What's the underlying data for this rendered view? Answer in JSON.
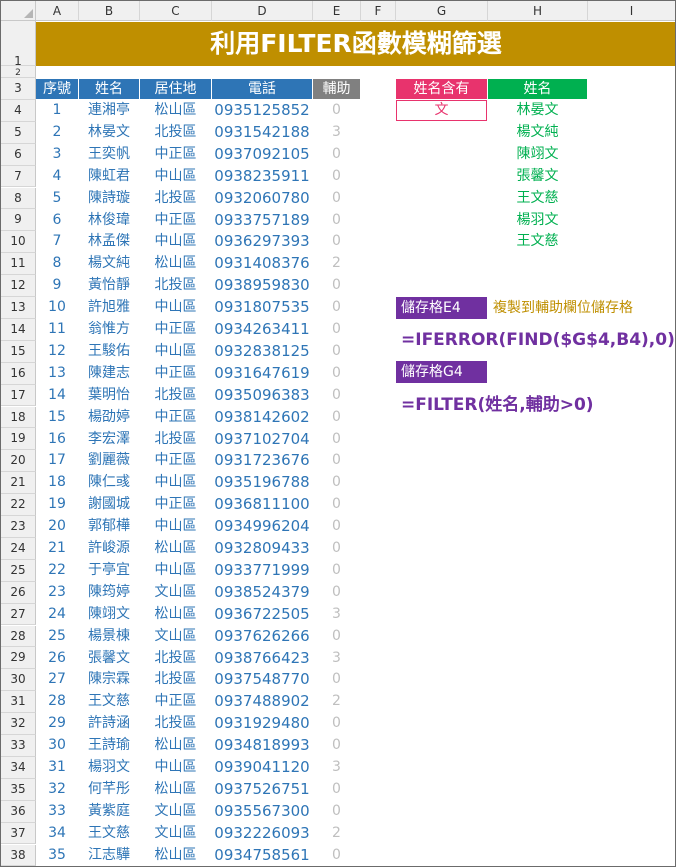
{
  "columns": [
    "A",
    "B",
    "C",
    "D",
    "E",
    "F",
    "G",
    "H",
    "I"
  ],
  "title": "利用FILTER函數模糊篩選",
  "table_headers": {
    "seq": "序號",
    "name": "姓名",
    "area": "居住地",
    "phone": "電話",
    "helper": "輔助"
  },
  "rows": [
    {
      "seq": "1",
      "name": "連湘亭",
      "area": "松山區",
      "phone": "0935125852",
      "helper": "0"
    },
    {
      "seq": "2",
      "name": "林晏文",
      "area": "北投區",
      "phone": "0931542188",
      "helper": "3"
    },
    {
      "seq": "3",
      "name": "王奕帆",
      "area": "中正區",
      "phone": "0937092105",
      "helper": "0"
    },
    {
      "seq": "4",
      "name": "陳虹君",
      "area": "中山區",
      "phone": "0938235911",
      "helper": "0"
    },
    {
      "seq": "5",
      "name": "陳詩璇",
      "area": "北投區",
      "phone": "0932060780",
      "helper": "0"
    },
    {
      "seq": "6",
      "name": "林俊瑋",
      "area": "中正區",
      "phone": "0933757189",
      "helper": "0"
    },
    {
      "seq": "7",
      "name": "林孟傑",
      "area": "中山區",
      "phone": "0936297393",
      "helper": "0"
    },
    {
      "seq": "8",
      "name": "楊文純",
      "area": "松山區",
      "phone": "0931408376",
      "helper": "2"
    },
    {
      "seq": "9",
      "name": "黃怡靜",
      "area": "北投區",
      "phone": "0938959830",
      "helper": "0"
    },
    {
      "seq": "10",
      "name": "許旭雅",
      "area": "中山區",
      "phone": "0931807535",
      "helper": "0"
    },
    {
      "seq": "11",
      "name": "翁惟方",
      "area": "中正區",
      "phone": "0934263411",
      "helper": "0"
    },
    {
      "seq": "12",
      "name": "王駿佑",
      "area": "中山區",
      "phone": "0932838125",
      "helper": "0"
    },
    {
      "seq": "13",
      "name": "陳建志",
      "area": "中正區",
      "phone": "0931647619",
      "helper": "0"
    },
    {
      "seq": "14",
      "name": "葉明怡",
      "area": "北投區",
      "phone": "0935096383",
      "helper": "0"
    },
    {
      "seq": "15",
      "name": "楊劭婷",
      "area": "中正區",
      "phone": "0938142602",
      "helper": "0"
    },
    {
      "seq": "16",
      "name": "李宏澤",
      "area": "北投區",
      "phone": "0937102704",
      "helper": "0"
    },
    {
      "seq": "17",
      "name": "劉麗薇",
      "area": "中正區",
      "phone": "0931723676",
      "helper": "0"
    },
    {
      "seq": "18",
      "name": "陳仁彧",
      "area": "中山區",
      "phone": "0935196788",
      "helper": "0"
    },
    {
      "seq": "19",
      "name": "謝國城",
      "area": "中正區",
      "phone": "0936811100",
      "helper": "0"
    },
    {
      "seq": "20",
      "name": "郭郁樺",
      "area": "中山區",
      "phone": "0934996204",
      "helper": "0"
    },
    {
      "seq": "21",
      "name": "許峻源",
      "area": "松山區",
      "phone": "0932809433",
      "helper": "0"
    },
    {
      "seq": "22",
      "name": "于亭宜",
      "area": "中山區",
      "phone": "0933771999",
      "helper": "0"
    },
    {
      "seq": "23",
      "name": "陳筠婷",
      "area": "文山區",
      "phone": "0938524379",
      "helper": "0"
    },
    {
      "seq": "24",
      "name": "陳翊文",
      "area": "松山區",
      "phone": "0936722505",
      "helper": "3"
    },
    {
      "seq": "25",
      "name": "楊景棟",
      "area": "文山區",
      "phone": "0937626266",
      "helper": "0"
    },
    {
      "seq": "26",
      "name": "張馨文",
      "area": "北投區",
      "phone": "0938766423",
      "helper": "3"
    },
    {
      "seq": "27",
      "name": "陳宗霖",
      "area": "北投區",
      "phone": "0937548770",
      "helper": "0"
    },
    {
      "seq": "28",
      "name": "王文慈",
      "area": "中正區",
      "phone": "0937488902",
      "helper": "2"
    },
    {
      "seq": "29",
      "name": "許詩涵",
      "area": "北投區",
      "phone": "0931929480",
      "helper": "0"
    },
    {
      "seq": "30",
      "name": "王詩瑜",
      "area": "松山區",
      "phone": "0934818993",
      "helper": "0"
    },
    {
      "seq": "31",
      "name": "楊羽文",
      "area": "中山區",
      "phone": "0939041120",
      "helper": "3"
    },
    {
      "seq": "32",
      "name": "何芊彤",
      "area": "松山區",
      "phone": "0937526751",
      "helper": "0"
    },
    {
      "seq": "33",
      "name": "黃紫庭",
      "area": "文山區",
      "phone": "0935567300",
      "helper": "0"
    },
    {
      "seq": "34",
      "name": "王文慈",
      "area": "文山區",
      "phone": "0932226093",
      "helper": "2"
    },
    {
      "seq": "35",
      "name": "江志驊",
      "area": "松山區",
      "phone": "0934758561",
      "helper": "0"
    }
  ],
  "criteria": {
    "header": "姓名含有",
    "value": "文"
  },
  "results": {
    "header": "姓名",
    "values": [
      "林晏文",
      "楊文純",
      "陳翊文",
      "張馨文",
      "王文慈",
      "楊羽文",
      "王文慈"
    ]
  },
  "notes": {
    "e4_label": "儲存格E4",
    "e4_note": "複製到輔助欄位儲存格",
    "e4_formula": "=IFERROR(FIND($G$4,B4),0)",
    "g4_label": "儲存格G4",
    "g4_formula": "=FILTER(姓名,輔助>0)"
  },
  "colors": {
    "title_bg": "#bf8f00",
    "header_blue": "#2e75b6",
    "criteria_pink": "#e8336d",
    "result_green": "#00b050",
    "formula_purple": "#7030a0"
  }
}
